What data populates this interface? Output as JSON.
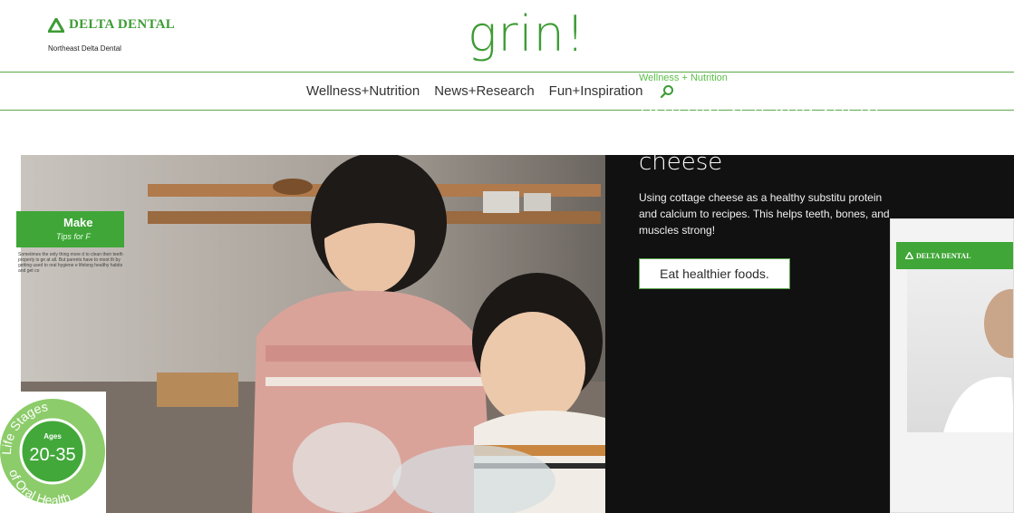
{
  "header": {
    "brand": "DELTA DENTAL",
    "brand_sub": "Northeast Delta Dental",
    "site_title": "grin!"
  },
  "nav": {
    "items": [
      {
        "label": "Wellness+Nutrition"
      },
      {
        "label": "News+Research"
      },
      {
        "label": "Fun+Inspiration"
      }
    ],
    "search_icon": "search-icon"
  },
  "hero": {
    "category": "Wellness + Nutrition",
    "title": "Protein-packed recip powered by cottage cheese",
    "description": "Using cottage cheese as a healthy substitu protein and calcium to recipes. This helps teeth, bones, and muscles strong!",
    "cta": "Eat healthier foods."
  },
  "promo": {
    "brand": "DELTA DENTAL",
    "headline": "Make",
    "subline": "Tips for F",
    "body": "Sometimes the only thing more d to clean their teeth properly is ge at all. But parents have to moot th by getting used to oral hygiene e lifelong healthy habits and get co"
  },
  "badge": {
    "top_text": "Life Stages",
    "ages_label": "Ages",
    "ages_value": "20-35",
    "bottom_text": "of Oral Health"
  },
  "colors": {
    "brand_green": "#3e9c35",
    "accent_green": "#5bbf47",
    "hero_dark": "#111111"
  }
}
